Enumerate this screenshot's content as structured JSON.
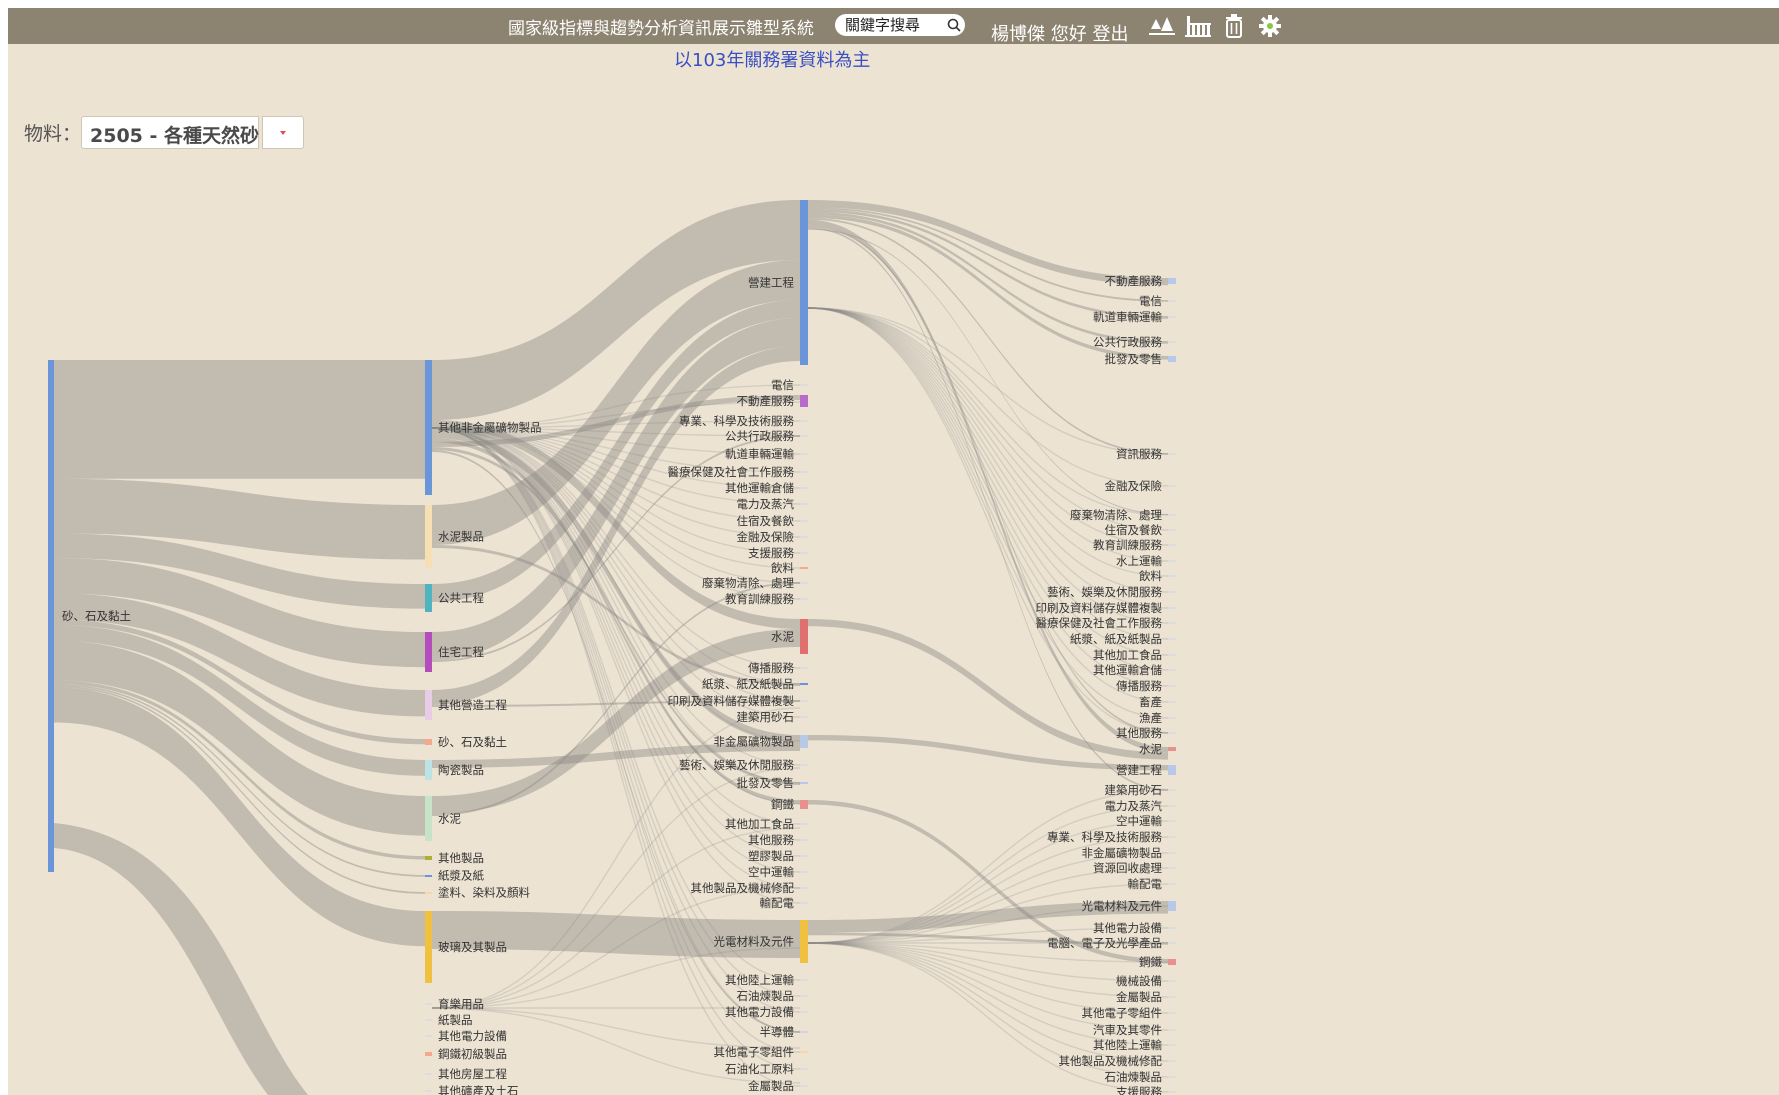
{
  "header": {
    "system_title": "國家級指標與趨勢分析資訊展示雛型系統",
    "search_placeholder": "關鍵字搜尋",
    "user_name": "楊博傑",
    "greeting": "您好",
    "logout": "登出",
    "subtitle": "以103年關務署資料為主"
  },
  "toolbar": {
    "buttons": [
      {
        "icon": "forest-chart-icon",
        "color": "#29a9e0"
      },
      {
        "icon": "factory-icon",
        "color": "#2a7fd4"
      },
      {
        "icon": "trash-icon",
        "color": "#f08a24"
      },
      {
        "icon": "gear-icon",
        "color": "#8cc63f"
      }
    ]
  },
  "material": {
    "label": "物料：",
    "selected": "2505 - 各種天然砂"
  },
  "sankey": {
    "level0": [
      {
        "name": "砂、石及黏土",
        "color": "#6a95d9"
      }
    ],
    "level1": [
      {
        "name": "其他非金屬礦物製品",
        "color": "#6a95d9"
      },
      {
        "name": "水泥製品",
        "color": "#f5dfb3"
      },
      {
        "name": "公共工程",
        "color": "#4db4c0"
      },
      {
        "name": "住宅工程",
        "color": "#b44dbb"
      },
      {
        "name": "其他營造工程",
        "color": "#e8cce6"
      },
      {
        "name": "砂、石及黏土",
        "color": "#f2a98c"
      },
      {
        "name": "陶瓷製品",
        "color": "#bde2e6"
      },
      {
        "name": "水泥",
        "color": "#c7e3c7"
      },
      {
        "name": "其他製品",
        "color": "#b0b030"
      },
      {
        "name": "紙漿及紙",
        "color": "#6a95d9"
      },
      {
        "name": "塗料、染料及顏料",
        "color": "#f5d9a0"
      },
      {
        "name": "玻璃及其製品",
        "color": "#f0c040"
      },
      {
        "name": "育樂用品",
        "color": "#ddd"
      },
      {
        "name": "紙製品",
        "color": "#ddd"
      },
      {
        "name": "其他電力設備",
        "color": "#ddd"
      },
      {
        "name": "鋼鐵初級製品",
        "color": "#f2a98c"
      },
      {
        "name": "其他房屋工程",
        "color": "#ddd"
      },
      {
        "name": "其他礦產及土石",
        "color": "#ddd"
      }
    ],
    "level2": [
      {
        "name": "營建工程",
        "color": "#6a95d9"
      },
      {
        "name": "電信",
        "color": "#ddd"
      },
      {
        "name": "不動產服務",
        "color": "#b86cc9"
      },
      {
        "name": "專業、科學及技術服務",
        "color": "#ddd"
      },
      {
        "name": "公共行政服務",
        "color": "#ddd"
      },
      {
        "name": "軌道車輛運輸",
        "color": "#ddd"
      },
      {
        "name": "醫療保健及社會工作服務",
        "color": "#ddd"
      },
      {
        "name": "其他運輸倉儲",
        "color": "#ddd"
      },
      {
        "name": "電力及蒸汽",
        "color": "#ddd"
      },
      {
        "name": "住宿及餐飲",
        "color": "#ddd"
      },
      {
        "name": "金融及保險",
        "color": "#ddd"
      },
      {
        "name": "支援服務",
        "color": "#ddd"
      },
      {
        "name": "飲料",
        "color": "#f2a98c"
      },
      {
        "name": "廢棄物清除、處理",
        "color": "#ddd"
      },
      {
        "name": "教育訓練服務",
        "color": "#ddd"
      },
      {
        "name": "水泥",
        "color": "#e07070"
      },
      {
        "name": "傳播服務",
        "color": "#ddd"
      },
      {
        "name": "紙漿、紙及紙製品",
        "color": "#6a95d9"
      },
      {
        "name": "印刷及資料儲存媒體複製",
        "color": "#ddd"
      },
      {
        "name": "建築用砂石",
        "color": "#ddd"
      },
      {
        "name": "非金屬礦物製品",
        "color": "#b8c8e8"
      },
      {
        "name": "藝術、娛樂及休閒服務",
        "color": "#ddd"
      },
      {
        "name": "批發及零售",
        "color": "#b8c8e8"
      },
      {
        "name": "鋼鐵",
        "color": "#e89090"
      },
      {
        "name": "其他加工食品",
        "color": "#ddd"
      },
      {
        "name": "其他服務",
        "color": "#ddd"
      },
      {
        "name": "塑膠製品",
        "color": "#ddd"
      },
      {
        "name": "空中運輸",
        "color": "#ddd"
      },
      {
        "name": "其他製品及機械修配",
        "color": "#ddd"
      },
      {
        "name": "輸配電",
        "color": "#ddd"
      },
      {
        "name": "光電材料及元件",
        "color": "#f0c040"
      },
      {
        "name": "其他陸上運輸",
        "color": "#ddd"
      },
      {
        "name": "石油煉製品",
        "color": "#ddd"
      },
      {
        "name": "其他電力設備",
        "color": "#ddd"
      },
      {
        "name": "半導體",
        "color": "#e8cce6"
      },
      {
        "name": "其他電子零組件",
        "color": "#f5d9a0"
      },
      {
        "name": "石油化工原料",
        "color": "#ddd"
      },
      {
        "name": "金屬製品",
        "color": "#ddd"
      }
    ],
    "level3": [
      {
        "name": "不動產服務",
        "color": "#b8c8e8"
      },
      {
        "name": "電信",
        "color": "#ddd"
      },
      {
        "name": "軌道車輛運輸",
        "color": "#ddd"
      },
      {
        "name": "公共行政服務",
        "color": "#ddd"
      },
      {
        "name": "批發及零售",
        "color": "#b8c8e8"
      },
      {
        "name": "資訊服務",
        "color": "#ddd"
      },
      {
        "name": "金融及保險",
        "color": "#ddd"
      },
      {
        "name": "廢棄物清除、處理",
        "color": "#ddd"
      },
      {
        "name": "住宿及餐飲",
        "color": "#ddd"
      },
      {
        "name": "教育訓練服務",
        "color": "#ddd"
      },
      {
        "name": "水上運輸",
        "color": "#ddd"
      },
      {
        "name": "飲料",
        "color": "#ddd"
      },
      {
        "name": "藝術、娛樂及休閒服務",
        "color": "#ddd"
      },
      {
        "name": "印刷及資料儲存媒體複製",
        "color": "#ddd"
      },
      {
        "name": "醫療保健及社會工作服務",
        "color": "#ddd"
      },
      {
        "name": "紙漿、紙及紙製品",
        "color": "#ddd"
      },
      {
        "name": "其他加工食品",
        "color": "#ddd"
      },
      {
        "name": "其他運輸倉儲",
        "color": "#ddd"
      },
      {
        "name": "傳播服務",
        "color": "#ddd"
      },
      {
        "name": "畜產",
        "color": "#ddd"
      },
      {
        "name": "漁產",
        "color": "#ddd"
      },
      {
        "name": "其他服務",
        "color": "#ddd"
      },
      {
        "name": "水泥",
        "color": "#e89090"
      },
      {
        "name": "營建工程",
        "color": "#b8c8e8"
      },
      {
        "name": "建築用砂石",
        "color": "#ddd"
      },
      {
        "name": "電力及蒸汽",
        "color": "#ddd"
      },
      {
        "name": "空中運輸",
        "color": "#ddd"
      },
      {
        "name": "專業、科學及技術服務",
        "color": "#ddd"
      },
      {
        "name": "非金屬礦物製品",
        "color": "#ddd"
      },
      {
        "name": "資源回收處理",
        "color": "#ddd"
      },
      {
        "name": "輸配電",
        "color": "#ddd"
      },
      {
        "name": "光電材料及元件",
        "color": "#b8c8e8"
      },
      {
        "name": "其他電力設備",
        "color": "#ddd"
      },
      {
        "name": "電腦、電子及光學產品",
        "color": "#ddd"
      },
      {
        "name": "鋼鐵",
        "color": "#e89090"
      },
      {
        "name": "機械設備",
        "color": "#ddd"
      },
      {
        "name": "金屬製品",
        "color": "#ddd"
      },
      {
        "name": "其他電子零組件",
        "color": "#ddd"
      },
      {
        "name": "汽車及其零件",
        "color": "#ddd"
      },
      {
        "name": "其他陸上運輸",
        "color": "#ddd"
      },
      {
        "name": "其他製品及機械修配",
        "color": "#ddd"
      },
      {
        "name": "石油煉製品",
        "color": "#ddd"
      },
      {
        "name": "支援服務",
        "color": "#ddd"
      }
    ],
    "links_01": [
      {
        "t": 0,
        "v": 135
      },
      {
        "t": 1,
        "v": 62
      },
      {
        "t": 2,
        "v": 28
      },
      {
        "t": 3,
        "v": 40
      },
      {
        "t": 4,
        "v": 30
      },
      {
        "t": 5,
        "v": 6
      },
      {
        "t": 6,
        "v": 18
      },
      {
        "t": 7,
        "v": 45
      },
      {
        "t": 8,
        "v": 4
      },
      {
        "t": 9,
        "v": 2
      },
      {
        "t": 10,
        "v": 2
      },
      {
        "t": 11,
        "v": 40
      }
    ],
    "links_12": [
      {
        "s": 0,
        "t": 0,
        "v": 60
      },
      {
        "s": 1,
        "t": 0,
        "v": 40
      },
      {
        "s": 2,
        "t": 0,
        "v": 18
      },
      {
        "s": 3,
        "t": 0,
        "v": 28
      },
      {
        "s": 4,
        "t": 0,
        "v": 15
      },
      {
        "s": 0,
        "t": 15,
        "v": 10
      },
      {
        "s": 7,
        "t": 15,
        "v": 18
      },
      {
        "s": 0,
        "t": 20,
        "v": 8
      },
      {
        "s": 6,
        "t": 20,
        "v": 8
      },
      {
        "s": 0,
        "t": 23,
        "v": 4
      },
      {
        "s": 11,
        "t": 30,
        "v": 38
      },
      {
        "s": 0,
        "t": 2,
        "v": 5
      },
      {
        "s": 1,
        "t": 17,
        "v": 3
      },
      {
        "s": 0,
        "t": 22,
        "v": 3
      },
      {
        "s": 4,
        "t": 18,
        "v": 2
      },
      {
        "s": 3,
        "t": 4,
        "v": 2
      },
      {
        "s": 7,
        "t": 13,
        "v": 2
      },
      {
        "s": 0,
        "t": 34,
        "v": 2
      }
    ],
    "links_23": [
      {
        "s": 0,
        "t": 0,
        "v": 8
      },
      {
        "s": 0,
        "t": 1,
        "v": 2
      },
      {
        "s": 0,
        "t": 2,
        "v": 3
      },
      {
        "s": 0,
        "t": 3,
        "v": 3
      },
      {
        "s": 0,
        "t": 4,
        "v": 4
      },
      {
        "s": 0,
        "t": 5,
        "v": 2
      },
      {
        "s": 0,
        "t": 22,
        "v": 6
      },
      {
        "s": 15,
        "t": 22,
        "v": 8
      },
      {
        "s": 20,
        "t": 23,
        "v": 6
      },
      {
        "s": 30,
        "t": 31,
        "v": 14
      },
      {
        "s": 23,
        "t": 34,
        "v": 5
      },
      {
        "s": 0,
        "t": 21,
        "v": 2
      },
      {
        "s": 0,
        "t": 24,
        "v": 2
      },
      {
        "s": 30,
        "t": 33,
        "v": 3
      },
      {
        "s": 0,
        "t": 7,
        "v": 1
      }
    ]
  }
}
